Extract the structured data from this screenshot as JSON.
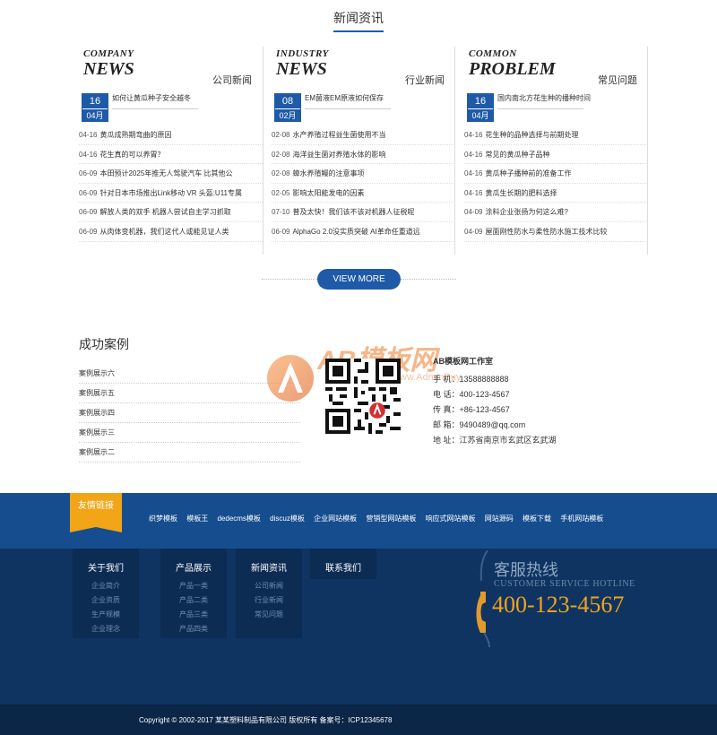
{
  "news_section": {
    "title": "新闻资讯",
    "columns": [
      {
        "en_small": "COMPANY",
        "en_big": "NEWS",
        "cn": "公司新闻",
        "featured": {
          "day": "16",
          "month": "04月",
          "title": "如何让黄瓜种子安全越冬"
        },
        "items": [
          {
            "date": "04-16",
            "title": "黄瓜成熟期弯曲的原因"
          },
          {
            "date": "04-16",
            "title": "花生真的可以养胃？"
          },
          {
            "date": "06-09",
            "title": "本田预计2025年推无人驾驶汽车 比其他公"
          },
          {
            "date": "06-09",
            "title": "针对日本市场推出Link移动 VR 头盔:U11专属"
          },
          {
            "date": "06-09",
            "title": "解放人类的双手 机器人尝试自主学习抓取"
          },
          {
            "date": "06-09",
            "title": "从肉体变机器，我们这代人或能见证人类"
          }
        ]
      },
      {
        "en_small": "INDUSTRY",
        "en_big": "NEWS",
        "cn": "行业新闻",
        "featured": {
          "day": "08",
          "month": "02月",
          "title": "EM菌液EM原液如何保存"
        },
        "items": [
          {
            "date": "02-08",
            "title": "水产养殖过程益生菌使用不当"
          },
          {
            "date": "02-08",
            "title": "海洋益生菌对养殖水体的影响"
          },
          {
            "date": "02-08",
            "title": "蟑水养殖鳗的注意事项"
          },
          {
            "date": "02-05",
            "title": "影响太阳能发电的因素"
          },
          {
            "date": "07-10",
            "title": "普及太快！我们该不该对机器人征税呢"
          },
          {
            "date": "06-09",
            "title": "AlphaGo 2.0没实质突破 AI革命任重道远"
          }
        ]
      },
      {
        "en_small": "COMMON",
        "en_big": "PROBLEM",
        "cn": "常见问题",
        "featured": {
          "day": "16",
          "month": "04月",
          "title": "国内南北方花生种的播种时间"
        },
        "items": [
          {
            "date": "04-16",
            "title": "花生种的品种选择与前期处理"
          },
          {
            "date": "04-16",
            "title": "常见的黄瓜种子品种"
          },
          {
            "date": "04-16",
            "title": "黄瓜种子播种前的准备工作"
          },
          {
            "date": "04-16",
            "title": "黄瓜生长期的肥料选择"
          },
          {
            "date": "04-09",
            "title": "涂料企业张扬为何这么难?"
          },
          {
            "date": "04-09",
            "title": "屋面刚性防水与柔性防水施工技术比较"
          }
        ]
      }
    ],
    "more_label": "VIEW MORE"
  },
  "cases": {
    "title": "成功案例",
    "items": [
      "案例展示六",
      "案例展示五",
      "案例展示四",
      "案例展示三",
      "案例展示二"
    ]
  },
  "watermark": {
    "text": "AB模板网",
    "sub": "www.AdminBuy.Cn"
  },
  "contact": {
    "company": "AB模板网工作室",
    "rows": [
      "手 机：13588888888",
      "电 话：400-123-4567",
      "传 真：+86-123-4567",
      "邮 箱：9490489@qq.com",
      "地 址：江苏省南京市玄武区玄武湖"
    ]
  },
  "friend_links": {
    "label": "友情链接",
    "items": [
      "织梦模板",
      "模板王",
      "dedecms模板",
      "discuz模板",
      "企业网站模板",
      "营销型网站模板",
      "响应式网站模板",
      "网站源码",
      "模板下载",
      "手机网站模板"
    ]
  },
  "footer_nav": [
    {
      "title": "关于我们",
      "items": [
        "企业简介",
        "企业资质",
        "生产规模",
        "企业理念"
      ]
    },
    {
      "title": "产品展示",
      "items": [
        "产品一类",
        "产品二类",
        "产品三类",
        "产品四类"
      ]
    },
    {
      "title": "新闻资讯",
      "items": [
        "公司新闻",
        "行业新闻",
        "常见问题"
      ]
    },
    {
      "title": "联系我们",
      "items": []
    }
  ],
  "hotline": {
    "label": "客服热线",
    "en": "CUSTOMER SERVICE HOTLINE",
    "number": "400-123-4567"
  },
  "copyright": "Copyright © 2002-2017 某某塑料制品有限公司 版权所有 备案号：ICP12345678",
  "colors": {
    "primary": "#1e5aa8",
    "accent": "#f2a516",
    "footer": "#0f3461",
    "hotline": "#f0a41c"
  }
}
